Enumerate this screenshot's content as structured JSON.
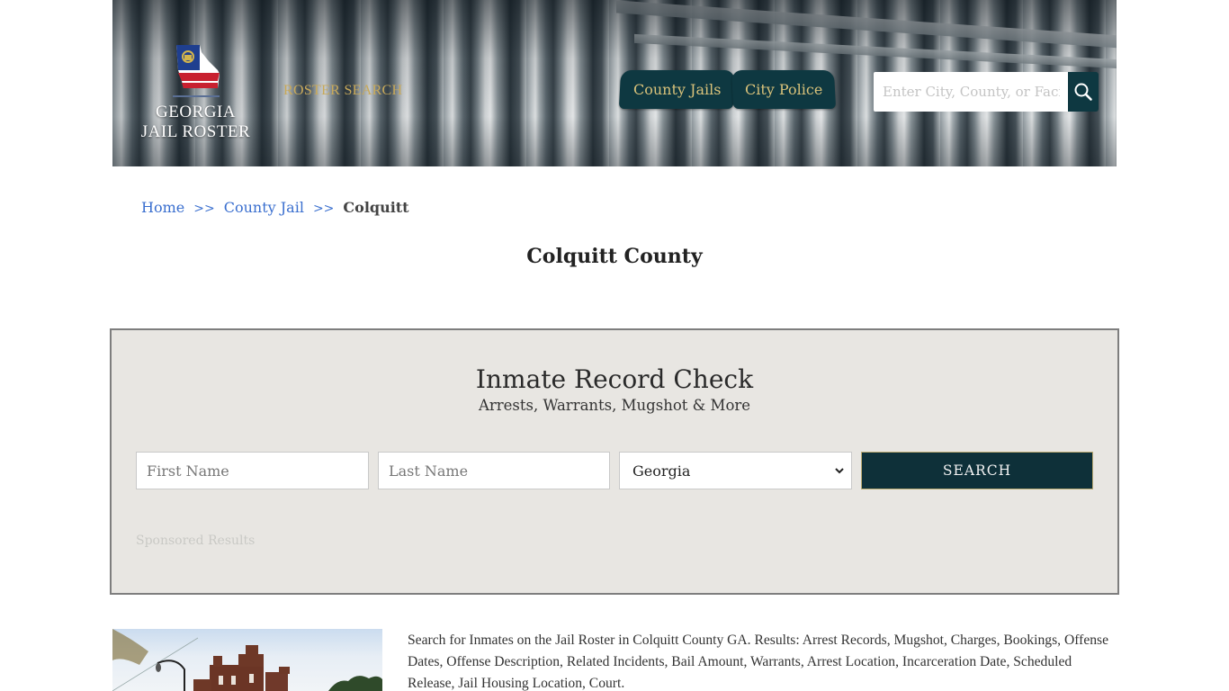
{
  "header": {
    "logo": {
      "line1": "GEORGIA",
      "line2": "JAIL ROSTER"
    },
    "roster_search_link": "ROSTER SEARCH",
    "nav": [
      {
        "label": "County Jails"
      },
      {
        "label": "City Police"
      }
    ],
    "search": {
      "placeholder": "Enter City, County, or Facility",
      "value": ""
    },
    "colors": {
      "nav_bg": "#0e3841",
      "nav_text": "#d9c27a",
      "roster_link": "#c8a95a"
    }
  },
  "breadcrumb": {
    "items": [
      {
        "label": "Home"
      },
      {
        "label": "County Jail"
      }
    ],
    "separator": ">>",
    "current": "Colquitt"
  },
  "page_title": "Colquitt County",
  "record_check": {
    "title": "Inmate Record Check",
    "subtitle": "Arrests, Warrants, Mugshot & More",
    "first_name": {
      "placeholder": "First Name",
      "value": ""
    },
    "last_name": {
      "placeholder": "Last Name",
      "value": ""
    },
    "state_select": {
      "selected": "Georgia"
    },
    "search_button": "SEARCH",
    "sponsored_label": "Sponsored Results"
  },
  "content": {
    "photo_alt": "Colquitt County jail building",
    "description": "Search for Inmates on the Jail Roster in Colquitt County GA. Results: Arrest Records, Mugshot, Charges, Bookings, Offense Dates, Offense Description, Related Incidents, Bail Amount, Warrants, Arrest Location, Incarceration Date, Scheduled Release, Jail Housing Location, Court."
  }
}
